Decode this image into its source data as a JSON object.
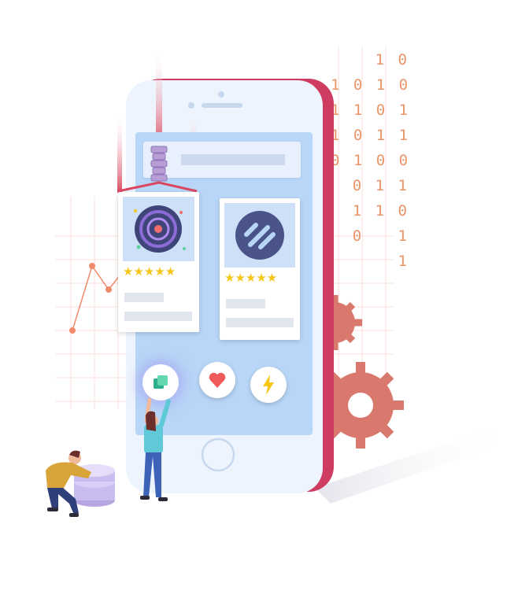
{
  "binary": {
    "rows": [
      "1 0",
      "1 0 1 0",
      "1 1 0 1",
      "1 0 1 1",
      "0 1 0 0",
      "0 1 1",
      "1 1 0",
      "0   1",
      "1"
    ]
  },
  "cards": [
    {
      "name": "galaxy-card",
      "rating": 5,
      "stars": "★★★★★"
    },
    {
      "name": "logo-card",
      "rating": 5,
      "stars": "★★★★★"
    }
  ],
  "buttons": {
    "app_icon": "app-icon",
    "heart_icon": "heart-icon",
    "bolt_icon": "lightning-icon"
  },
  "colors": {
    "phone_body": "#cf3c62",
    "screen": "#b8d6f7",
    "gear": "#d9786c",
    "binary_text": "#e8956a",
    "star": "#f5c518"
  }
}
